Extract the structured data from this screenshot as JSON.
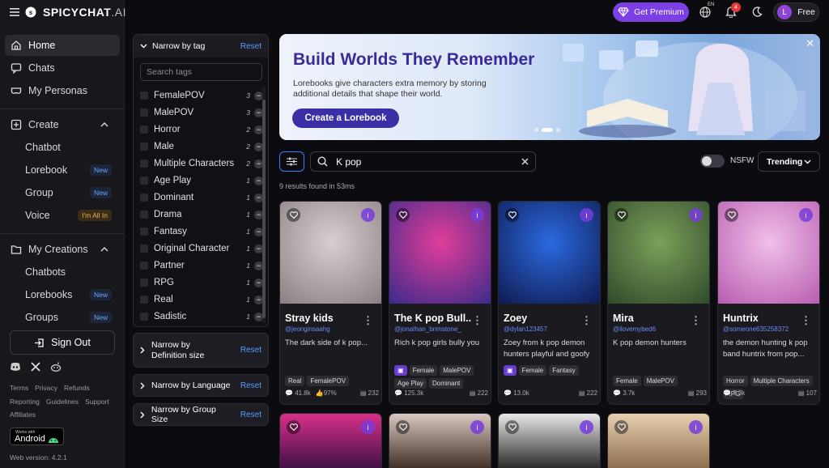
{
  "brand": {
    "name": "SPICYCHAT",
    "suffix": ".AI"
  },
  "nav": {
    "home": "Home",
    "chats": "Chats",
    "personas": "My Personas",
    "create": "Create",
    "create_items": [
      {
        "label": "Chatbot",
        "badge": ""
      },
      {
        "label": "Lorebook",
        "badge": "New"
      },
      {
        "label": "Group",
        "badge": "New"
      },
      {
        "label": "Voice",
        "badge": "I'm All In"
      }
    ],
    "my_creations": "My Creations",
    "creation_items": [
      {
        "label": "Chatbots",
        "badge": ""
      },
      {
        "label": "Lorebooks",
        "badge": "New"
      },
      {
        "label": "Groups",
        "badge": "New"
      }
    ],
    "sign_out": "Sign Out"
  },
  "footer": {
    "links_row1": [
      "Terms",
      "Privacy",
      "Refunds"
    ],
    "links_row2": [
      "Reporting",
      "Guidelines",
      "Support"
    ],
    "links_row3": [
      "Affiliates"
    ],
    "android_small": "Works with",
    "android_big": "Android",
    "version": "Web version: 4.2.1"
  },
  "topbar": {
    "premium": "Get Premium",
    "lang": "EN",
    "notifications": "4",
    "avatar_letter": "L",
    "plan": "Free"
  },
  "filter": {
    "title": "Narrow by tag",
    "reset": "Reset",
    "search_placeholder": "Search tags",
    "tags": [
      {
        "label": "FemalePOV",
        "count": "3"
      },
      {
        "label": "MalePOV",
        "count": "3"
      },
      {
        "label": "Horror",
        "count": "2"
      },
      {
        "label": "Male",
        "count": "2"
      },
      {
        "label": "Multiple Characters",
        "count": "2"
      },
      {
        "label": "Age Play",
        "count": "1"
      },
      {
        "label": "Dominant",
        "count": "1"
      },
      {
        "label": "Drama",
        "count": "1"
      },
      {
        "label": "Fantasy",
        "count": "1"
      },
      {
        "label": "Original Character",
        "count": "1"
      },
      {
        "label": "Partner",
        "count": "1"
      },
      {
        "label": "RPG",
        "count": "1"
      },
      {
        "label": "Real",
        "count": "1"
      },
      {
        "label": "Sadistic",
        "count": "1"
      }
    ],
    "definition_size": "Narrow by Definition size",
    "language": "Narrow by Language",
    "group_size": "Narrow by Group Size"
  },
  "banner": {
    "title": "Build Worlds They Remember",
    "description": "Lorebooks give characters extra memory by storing additional details that shape their world.",
    "cta": "Create a Lorebook"
  },
  "search": {
    "value": "K pop",
    "nsfw_label": "NSFW",
    "sort": "Trending",
    "results": "9 results found in 53ms"
  },
  "cards": [
    {
      "name": "Stray kids",
      "handle": "@jeonginsaahg",
      "desc": "The dark side of k pop...",
      "tags": [
        "Real",
        "FemalePOV"
      ],
      "chats": "41.8k",
      "likes": "97%",
      "tokens": "232",
      "colors": [
        "#d9cfd2",
        "#8a7f83"
      ]
    },
    {
      "name": "The K pop Bull...",
      "handle": "@jonathan_brimstone_",
      "desc": "Rich k pop girls bully you",
      "tags": [
        "Female",
        "MalePOV",
        "Age Play",
        "Dominant"
      ],
      "chats": "125.3k",
      "likes": "",
      "tokens": "222",
      "colors": [
        "#e23d9a",
        "#3a2a8a"
      ]
    },
    {
      "name": "Zoey",
      "handle": "@dylan123457",
      "desc": "Zoey from k pop demon hunters playful and goofy",
      "tags": [
        "Female",
        "Fantasy"
      ],
      "chats": "13.0k",
      "likes": "",
      "tokens": "222",
      "colors": [
        "#2a6ae0",
        "#101a50"
      ]
    },
    {
      "name": "Mira",
      "handle": "@ilovemybed6",
      "desc": "K pop demon hunters",
      "tags": [
        "Female",
        "MalePOV"
      ],
      "chats": "3.7k",
      "likes": "",
      "tokens": "293",
      "colors": [
        "#7aa05a",
        "#2f4a2a"
      ]
    },
    {
      "name": "Huntrix",
      "handle": "@someone635258372",
      "desc": "the demon hunting k pop band huntrix from pop...",
      "tags": [
        "Horror",
        "Multiple Characters",
        "RPG"
      ],
      "chats": "7.3k",
      "likes": "",
      "tokens": "107",
      "colors": [
        "#f0c0e8",
        "#b85cb0"
      ]
    }
  ],
  "bottom_cards": [
    {
      "colors": [
        "#d8308a",
        "#3a1040"
      ]
    },
    {
      "colors": [
        "#d8c8c0",
        "#3a2a22"
      ]
    },
    {
      "colors": [
        "#e8e8e8",
        "#222222"
      ]
    },
    {
      "colors": [
        "#e8d0b0",
        "#8a6a4a"
      ]
    }
  ]
}
